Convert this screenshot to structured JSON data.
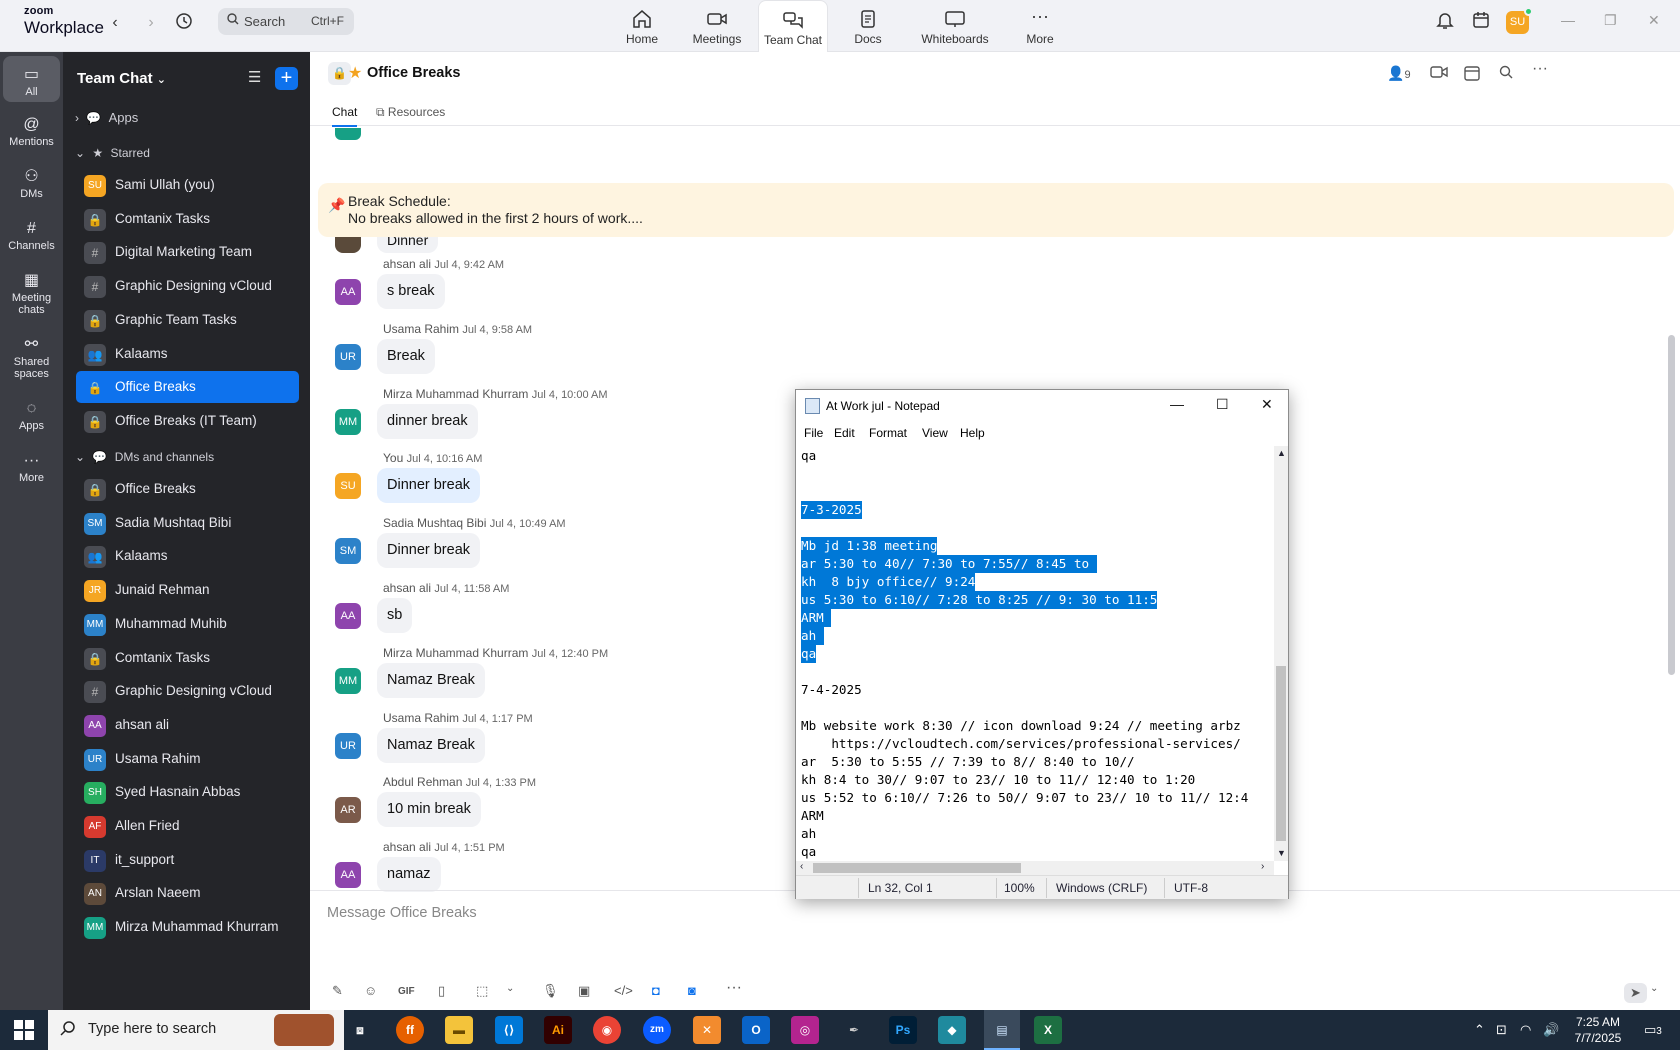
{
  "app": {
    "brand_line1": "zoom",
    "brand_line2": "Workplace"
  },
  "search": {
    "placeholder": "Search",
    "shortcut": "Ctrl+F"
  },
  "nav": {
    "tabs": [
      {
        "label": "Home"
      },
      {
        "label": "Meetings"
      },
      {
        "label": "Team Chat"
      },
      {
        "label": "Docs"
      },
      {
        "label": "Whiteboards"
      },
      {
        "label": "More"
      }
    ]
  },
  "user": {
    "initials": "SU"
  },
  "rail": {
    "items": [
      {
        "label": "All"
      },
      {
        "label": "Mentions"
      },
      {
        "label": "DMs"
      },
      {
        "label": "Channels"
      },
      {
        "label": "Meeting chats"
      },
      {
        "label": "Shared spaces"
      },
      {
        "label": "Apps"
      },
      {
        "label": "More"
      }
    ]
  },
  "sidebar": {
    "title": "Team Chat",
    "apps_label": "Apps",
    "starred_label": "Starred",
    "starred": [
      {
        "label": "Sami Ullah (you)",
        "initials": "SU",
        "color": "#f5a623"
      },
      {
        "label": "Comtanix Tasks",
        "initials": "🔒"
      },
      {
        "label": "Digital Marketing Team",
        "initials": "#"
      },
      {
        "label": "Graphic Designing vCloud",
        "initials": "#"
      },
      {
        "label": "Graphic Team Tasks",
        "initials": "🔒"
      },
      {
        "label": "Kalaams",
        "initials": "👥"
      },
      {
        "label": "Office Breaks",
        "initials": "🔒"
      },
      {
        "label": "Office Breaks (IT Team)",
        "initials": "🔒"
      }
    ],
    "dms_label": "DMs and channels",
    "dms": [
      {
        "label": "Office Breaks",
        "initials": "🔒"
      },
      {
        "label": "Sadia Mushtaq Bibi",
        "initials": "SM",
        "color": "#2c82c9"
      },
      {
        "label": "Kalaams",
        "initials": "👥"
      },
      {
        "label": "Junaid Rehman",
        "initials": "JR",
        "color": "#f5a623"
      },
      {
        "label": "Muhammad Muhib",
        "initials": "MM",
        "color": "#2c82c9"
      },
      {
        "label": "Comtanix Tasks",
        "initials": "🔒"
      },
      {
        "label": "Graphic Designing vCloud",
        "initials": "#"
      },
      {
        "label": "ahsan ali",
        "initials": "AA",
        "color": "#8e44ad"
      },
      {
        "label": "Usama Rahim",
        "initials": "UR",
        "color": "#2c82c9"
      },
      {
        "label": "Syed Hasnain Abbas",
        "initials": "SH",
        "color": "#27ae60"
      },
      {
        "label": "Allen Fried",
        "initials": "AF",
        "color": "#d63a2f"
      },
      {
        "label": "it_support",
        "initials": "IT",
        "color": "#2b3a67"
      },
      {
        "label": "Arslan Naeem",
        "initials": "AN",
        "color": "#5d4a3a"
      },
      {
        "label": "Mirza Muhammad Khurram",
        "initials": "MM",
        "color": "#16a085"
      }
    ]
  },
  "channel": {
    "name": "Office Breaks",
    "member_count": "9",
    "tab_chat": "Chat",
    "tab_resources": "Resources"
  },
  "pinned": {
    "line1": "Break Schedule:",
    "line2": "No breaks allowed in the first 2 hours of work...."
  },
  "partial_message": "Dinner",
  "messages": [
    {
      "sender": "ahsan ali",
      "time": "Jul 4, 9:42 AM",
      "text": "s break",
      "initials": "AA",
      "color": "#8e44ad"
    },
    {
      "sender": "Usama Rahim",
      "time": "Jul 4, 9:58 AM",
      "text": "Break",
      "initials": "UR",
      "color": "#2c82c9"
    },
    {
      "sender": "Mirza Muhammad Khurram",
      "time": "Jul 4, 10:00 AM",
      "text": "dinner break",
      "initials": "MM",
      "color": "#16a085"
    },
    {
      "sender": "You",
      "time": "Jul 4, 10:16 AM",
      "text": "Dinner break",
      "initials": "SU",
      "color": "#f5a623",
      "mine": true
    },
    {
      "sender": "Sadia Mushtaq Bibi",
      "time": "Jul 4, 10:49 AM",
      "text": "Dinner break",
      "initials": "SM",
      "color": "#2c82c9"
    },
    {
      "sender": "ahsan ali",
      "time": "Jul 4, 11:58 AM",
      "text": "sb",
      "initials": "AA",
      "color": "#8e44ad"
    },
    {
      "sender": "Mirza Muhammad Khurram",
      "time": "Jul 4, 12:40 PM",
      "text": "Namaz Break",
      "initials": "MM",
      "color": "#16a085"
    },
    {
      "sender": "Usama Rahim",
      "time": "Jul 4, 1:17 PM",
      "text": "Namaz Break",
      "initials": "UR",
      "color": "#2c82c9"
    },
    {
      "sender": "Abdul Rehman",
      "time": "Jul 4, 1:33 PM",
      "text": "10 min break",
      "initials": "AR",
      "color": "#7b5a4a"
    },
    {
      "sender": "ahsan ali",
      "time": "Jul 4, 1:51 PM",
      "text": "namaz",
      "initials": "AA",
      "color": "#8e44ad"
    }
  ],
  "composer": {
    "placeholder": "Message Office Breaks",
    "gif": "GIF"
  },
  "notepad": {
    "title": "At Work jul - Notepad",
    "menu": [
      "File",
      "Edit",
      "Format",
      "View",
      "Help"
    ],
    "lines": [
      {
        "t": "qa",
        "sel": false
      },
      {
        "t": "",
        "sel": false
      },
      {
        "t": "",
        "sel": false
      },
      {
        "t": "7-3-2025",
        "sel": true
      },
      {
        "t": "",
        "sel": false
      },
      {
        "t": "Mb jd 1:38 meeting",
        "sel": true
      },
      {
        "t": "ar 5:30 to 40// 7:30 to 7:55// 8:45 to ",
        "sel": true
      },
      {
        "t": "kh  8 bjy office// 9:24",
        "sel": true
      },
      {
        "t": "us 5:30 to 6:10// 7:28 to 8:25 // 9: 30 to 11:5",
        "sel": true
      },
      {
        "t": "ARM ",
        "sel": true
      },
      {
        "t": "ah ",
        "sel": true
      },
      {
        "t": "qa",
        "sel": true
      },
      {
        "t": "",
        "sel": false
      },
      {
        "t": "7-4-2025",
        "sel": false
      },
      {
        "t": "",
        "sel": false
      },
      {
        "t": "Mb website work 8:30 // icon download 9:24 // meeting arbz",
        "sel": false
      },
      {
        "t": "    https://vcloudtech.com/services/professional-services/",
        "sel": false
      },
      {
        "t": "ar  5:30 to 5:55 // 7:39 to 8// 8:40 to 10//",
        "sel": false
      },
      {
        "t": "kh 8:4 to 30// 9:07 to 23// 10 to 11// 12:40 to 1:20",
        "sel": false
      },
      {
        "t": "us 5:52 to 6:10// 7:26 to 50// 9:07 to 23// 10 to 11// 12:4",
        "sel": false
      },
      {
        "t": "ARM",
        "sel": false
      },
      {
        "t": "ah",
        "sel": false
      },
      {
        "t": "qa",
        "sel": false
      }
    ],
    "status": {
      "position": "Ln 32, Col 1",
      "zoom": "100%",
      "eol": "Windows (CRLF)",
      "encoding": "UTF-8"
    }
  },
  "taskbar": {
    "search_placeholder": "Type here to search",
    "time": "7:25 AM",
    "date": "7/7/2025",
    "notifications": "3"
  }
}
